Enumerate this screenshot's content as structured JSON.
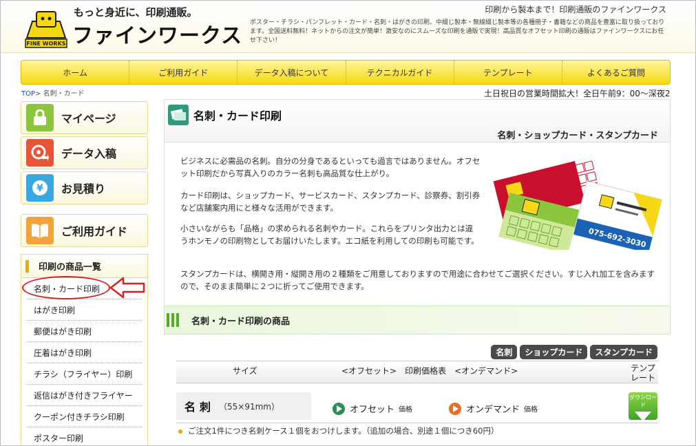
{
  "header": {
    "tagline": "もっと身近に、印刷通販。",
    "brand": "ファインワークス",
    "logo_caption": "FINE WORKS",
    "top_right": "印刷から製本まで！印刷通販のファインワークス",
    "intro": "ポスター・チラシ・パンフレット・カード・名刺・はがきの印刷、中綴じ製本・無線綴じ製本等の各種冊子・書籍などの商品を豊富に取り扱っております。全国送料無料！ネットからの注文が簡単！激安なのにスムーズな印刷を通販で実現！高品質なオフセット印刷の通販はファインワークスにお任せ下さい！"
  },
  "nav": [
    "ホーム",
    "ご利用ガイド",
    "データ入稿について",
    "テクニカルガイド",
    "テンプレート",
    "よくあるご質問"
  ],
  "breadcrumb": {
    "top": "TOP",
    "current": "> 名刺・カード"
  },
  "hours": "土日祝日の営業時間拡大！全日午前9：00～深夜2",
  "sidebar": {
    "buttons": [
      {
        "label": "マイページ",
        "color": "#8cc63f"
      },
      {
        "label": "データ入稿",
        "color": "#e8543a"
      },
      {
        "label": "お見積り",
        "color": "#3aa7e0"
      },
      {
        "label": "ご利用ガイド",
        "color": "#f4a23a"
      }
    ],
    "list_title": "印刷の商品一覧",
    "list": [
      "名刺・カード印刷",
      "はがき印刷",
      "郵便はがき印刷",
      "圧着はがき印刷",
      "チラシ（フライヤー）印刷",
      "返信はがき付きフライヤー",
      "クーポン付きチラシ印刷",
      "ポスター印刷"
    ]
  },
  "main": {
    "title": "名刺・カード印刷",
    "subtitle": "名刺・ショップカード・スタンプカード",
    "paragraphs": [
      "ビジネスに必需品の名刺。自分の分身であるといっても過言ではありません。オフセット印刷だから写真入りのカラー名刺も高品質な仕上がり。",
      "カード印刷は、ショップカード、サービスカード、スタンプカード、診察券、割引券など店舗案内用にと様々な活用ができます。",
      "小さいながらも「品格」の求められる名刺やカード。これらをプリンタ出力とは違うホンモノの印刷物としてお届けいたします。エコ紙を利用しての印刷も可能です。",
      "スタンプカードは、横開き用・縦開き用の２種類をご用意しておりますので用途に合わせてご選択ください。すじ入れ加工を含みますので、そのまま簡単に２つに折ってご使用できます。"
    ],
    "card_phone": "075-692-3030",
    "products_title": "名刺・カード印刷の商品",
    "tabs": [
      "名刺",
      "ショップカード",
      "スタンプカード"
    ],
    "table_head": {
      "size": "サイズ",
      "price": "<オフセット>　印刷価格表　<オンデマンド>",
      "template": "テンプレート"
    },
    "row": {
      "name": "名刺",
      "dimension": "（55×91mm）",
      "offset": "オフセット",
      "ondemand": "オンデマンド",
      "price_label": "価格",
      "download": "ダウンロード",
      "note": "ご注文1件につき名刺ケース１個をおつけします。（追加の場合、別途１個につき60円）"
    }
  }
}
